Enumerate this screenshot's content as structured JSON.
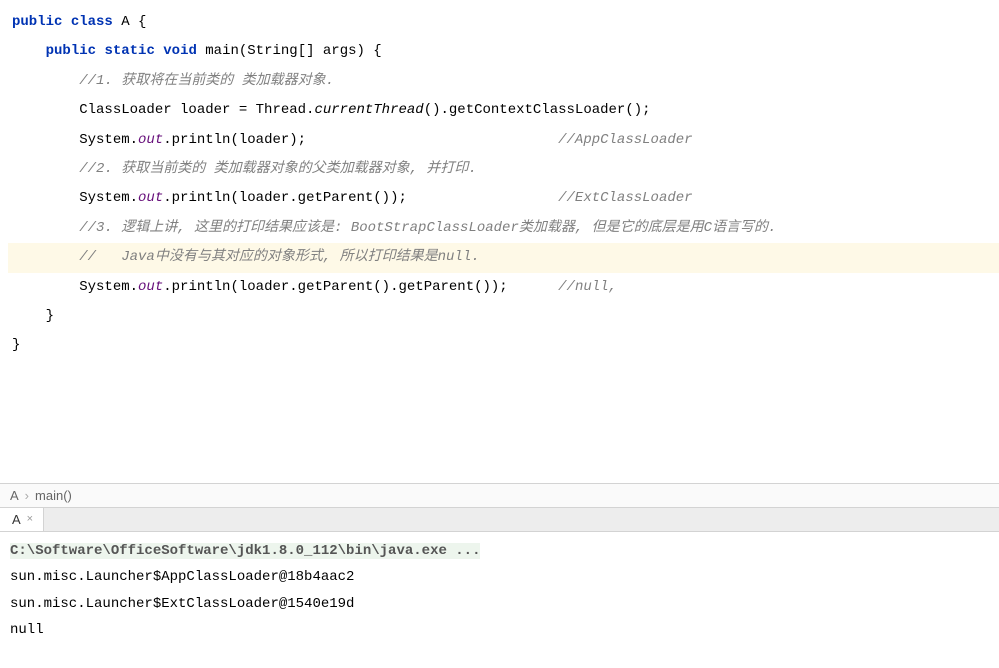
{
  "code": {
    "line1_kw_public": "public",
    "line1_kw_class": "class",
    "line1_classname": " A {",
    "line2_kw_public": "public",
    "line2_kw_static": "static",
    "line2_kw_void": "void",
    "line2_method": " main(String[] args) {",
    "comment1": "//1. 获取将在当前类的 类加载器对象.",
    "line4_a": "ClassLoader loader = Thread.",
    "line4_b": "currentThread",
    "line4_c": "().getContextClassLoader();",
    "line5_a": "System.",
    "line5_out": "out",
    "line5_b": ".println(loader);",
    "line5_comment": "//AppClassLoader",
    "comment2": "//2. 获取当前类的 类加载器对象的父类加载器对象, 并打印.",
    "line7_a": "System.",
    "line7_out": "out",
    "line7_b": ".println(loader.getParent());",
    "line7_comment": "//ExtClassLoader",
    "comment3": "//3. 逻辑上讲, 这里的打印结果应该是: BootStrapClassLoader类加载器, 但是它的底层是用C语言写的.",
    "comment4": "//   Java中没有与其对应的对象形式, 所以打印结果是null.",
    "line10_a": "System.",
    "line10_out": "out",
    "line10_b": ".println(loader.getParent().getParent());",
    "line10_comment": "//null,",
    "close1": "}",
    "close2": "}"
  },
  "breadcrumb": {
    "item1": "A",
    "sep": "›",
    "item2": "main()"
  },
  "tab": {
    "label": "A",
    "close": "×"
  },
  "console": {
    "cmd": "C:\\Software\\OfficeSoftware\\jdk1.8.0_112\\bin\\java.exe ...",
    "line1": "sun.misc.Launcher$AppClassLoader@18b4aac2",
    "line2": "sun.misc.Launcher$ExtClassLoader@1540e19d",
    "line3": "null"
  }
}
